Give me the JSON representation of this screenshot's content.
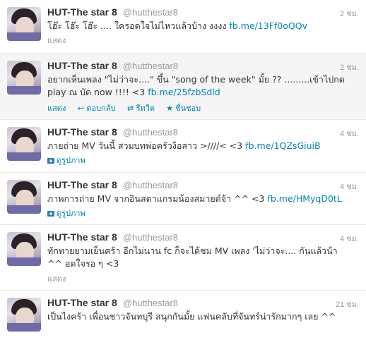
{
  "tweets": [
    {
      "name": "HUT-The star 8",
      "handle": "@hutthestar8",
      "time": "2 ชม.",
      "text": "โฮ๊ะ โฮ๊ะ โฮ๊ะ .... ใครอดใจไม่ไหวแล้วบ้าง งงงง ",
      "link": "fb.me/13Ff0oQQv",
      "expand": "แสดง"
    },
    {
      "name": "HUT-The star 8",
      "handle": "@hutthestar8",
      "time": "2 ชม.",
      "text_line1": "อยากเห็นเพลง \"ไม่ว่าจะ....\" ขึ้น \"song of the week\" มั้ย ?? .........เข้าไปกด",
      "text_line2": "play ณ บัด now !!!! <3 ",
      "link": "fb.me/25fzbSdld",
      "expand": "แสดง",
      "reply": "ตอบกลับ",
      "retweet": "รีทวีต",
      "favorite": "ชื่นชอบ"
    },
    {
      "name": "HUT-The star 8",
      "handle": "@hutthestar8",
      "time": "4 ชม.",
      "text": "ภายถ่าย MV วันนี้ สวมบทพ่อครัวง้อสาว >////< <3 ",
      "link": "fb.me/1QZsGiuiB",
      "photo": "ดูรูปภาพ"
    },
    {
      "name": "HUT-The star 8",
      "handle": "@hutthestar8",
      "time": "4 ชม.",
      "text": "ภาพการถ่าย MV จากอินสตาแกรมน้องสมายด์จ้า ^^ <3 ",
      "link": "fb.me/HMyqD0tL",
      "photo": "ดูรูปภาพ"
    },
    {
      "name": "HUT-The star 8",
      "handle": "@hutthestar8",
      "time": "4 ชม.",
      "text_line1": "ทักทายยามเย็นคร้า อีกไม่นาน fc ก็จะได้ชม MV เพลง 'ไม่ว่าจะ.... กันแล้วน้า",
      "text_line2": "^^ อดใจรอ ๆ <3",
      "expand": "แสดง"
    },
    {
      "name": "HUT-The star 8",
      "handle": "@hutthestar8",
      "time": "21 ชม.",
      "text": "เป็นไงคร้า เพื่อนชาวจันทบุรี สนุกกันมั้ย แฟนคลับที่จันทร์น่ารักมากๆ เลย ^^"
    }
  ]
}
